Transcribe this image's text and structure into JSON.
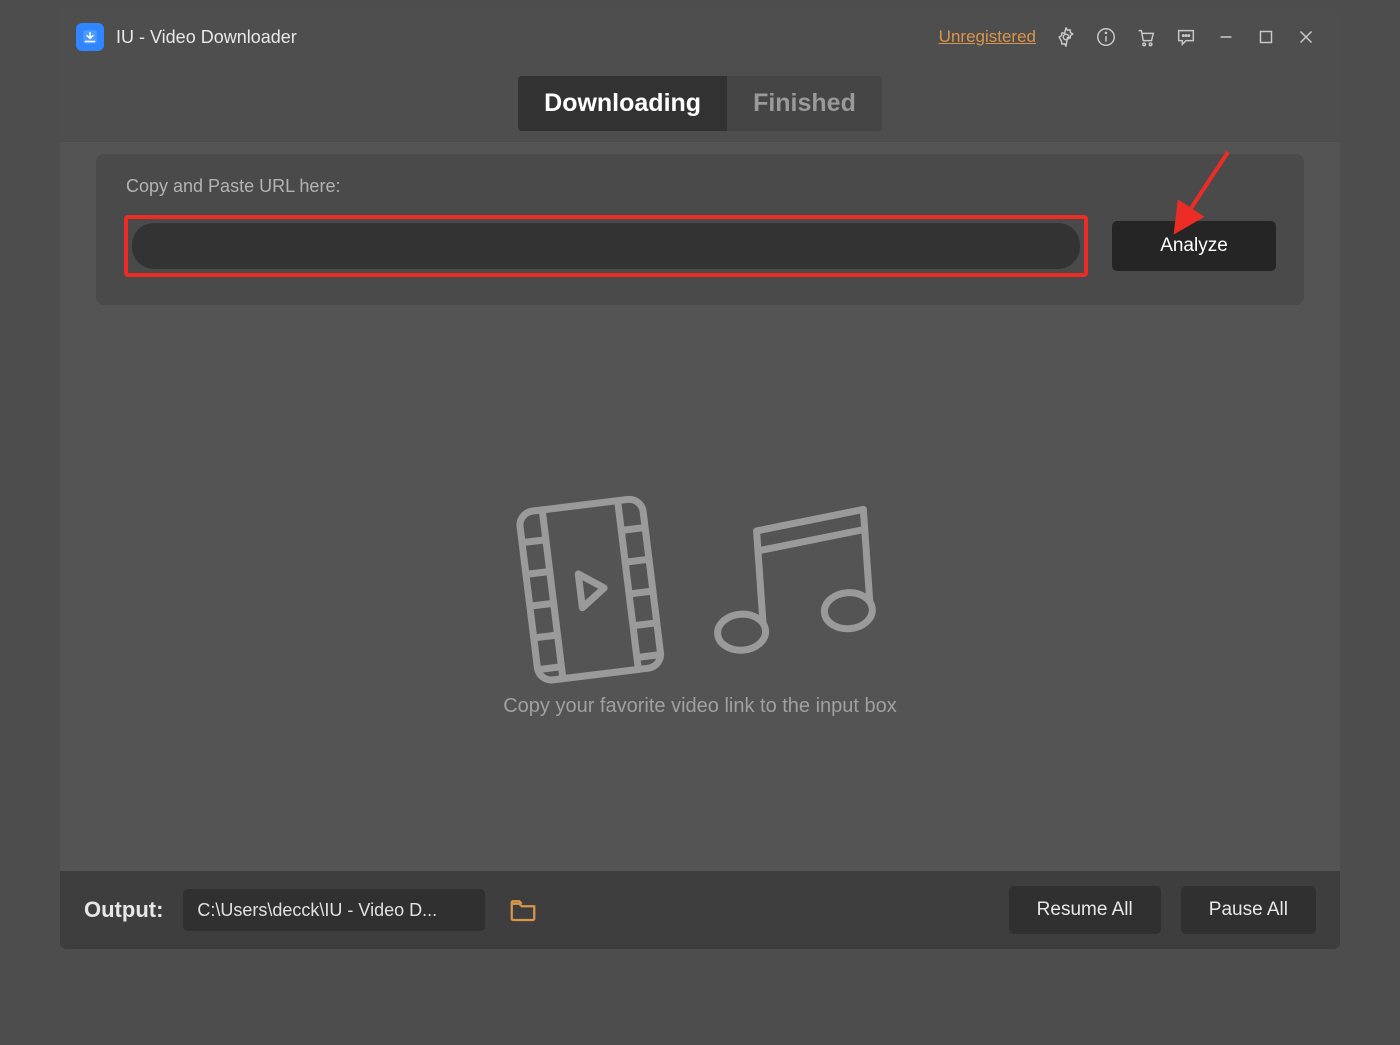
{
  "titlebar": {
    "title": "IU - Video Downloader",
    "unregistered": "Unregistered"
  },
  "tabs": {
    "downloading": "Downloading",
    "finished": "Finished"
  },
  "urlPanel": {
    "label": "Copy and Paste URL here:",
    "value": "",
    "analyze": "Analyze"
  },
  "empty": {
    "hint": "Copy your favorite video link to the input box"
  },
  "bottom": {
    "outputLabel": "Output:",
    "path": "C:\\Users\\decck\\IU - Video D...",
    "resume": "Resume All",
    "pause": "Pause All"
  }
}
